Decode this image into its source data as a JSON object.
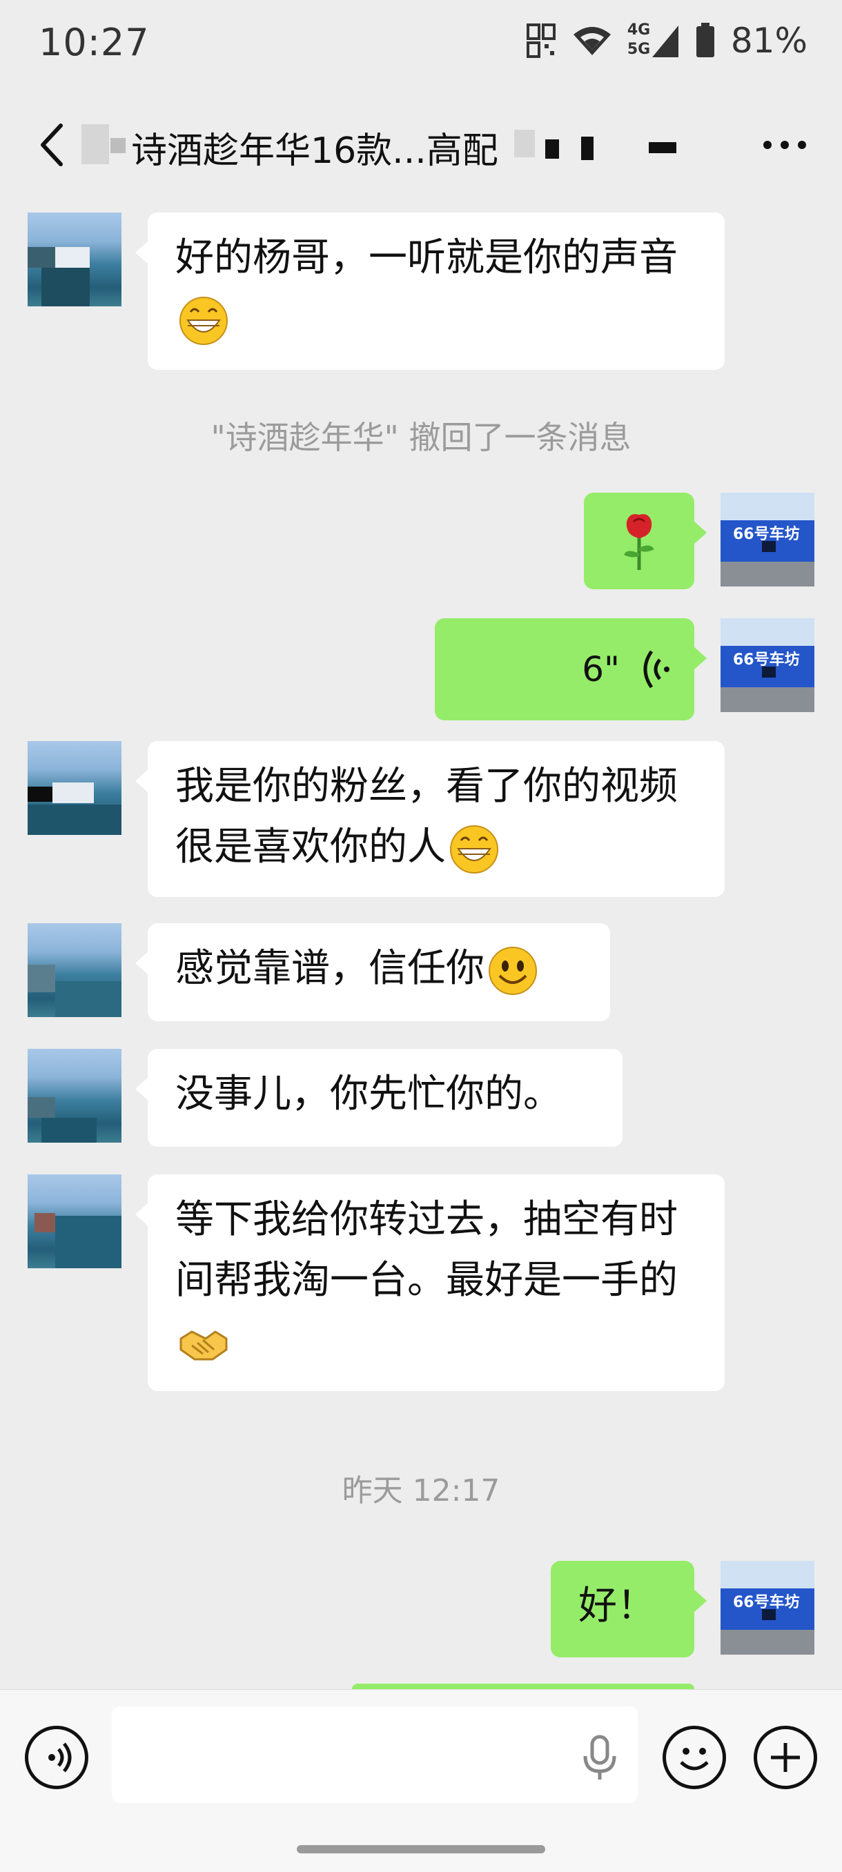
{
  "status_bar": {
    "time": "10:27",
    "network_4g": "4G",
    "network_5g": "5G",
    "battery": "81%"
  },
  "nav": {
    "title": "诗酒趁年华16款...高配"
  },
  "messages": {
    "m1": "好的杨哥，一听就是你的声音",
    "recall": "\"诗酒趁年华\" 撤回了一条消息",
    "m3_voice_duration": "6\"",
    "m4": "我是你的粉丝，看了你的视频很是喜欢你的人",
    "m5": "感觉靠谱，信任你",
    "m6": "没事儿，你先忙你的。",
    "m7": "等下我给你转过去，抽空有时间帮我淘一台。最好是一手的",
    "time_divider": "昨天 12:17",
    "m8": "好！"
  },
  "my_avatar_text": "66号车坊",
  "colors": {
    "background": "#ededed",
    "my_bubble": "#95ec69",
    "other_bubble": "#ffffff",
    "system_text": "#9b9b9b"
  },
  "icons": {
    "back": "chevron-left-icon",
    "more": "more-icon",
    "voice_mode": "voice-input-icon",
    "mic": "microphone-icon",
    "emoji": "emoji-icon",
    "plus": "plus-icon"
  }
}
